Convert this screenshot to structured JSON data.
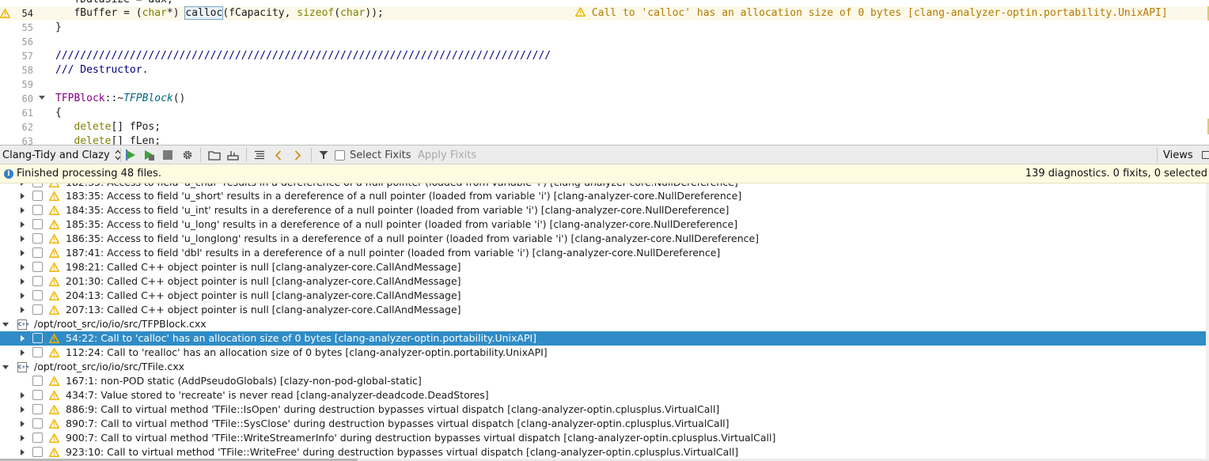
{
  "editor": {
    "lines": [
      {
        "num": "",
        "text": "   fDataSize = aux;"
      },
      {
        "num": "54",
        "current": true
      },
      {
        "num": "55",
        "text": "}"
      },
      {
        "num": "56",
        "text": ""
      },
      {
        "num": "57",
        "text": "////////////////////////////////////////////////////////////////////////////////"
      },
      {
        "num": "58",
        "text": "/// Destructor."
      },
      {
        "num": "59",
        "text": ""
      },
      {
        "num": "60"
      },
      {
        "num": "61",
        "text": "{"
      },
      {
        "num": "62"
      },
      {
        "num": "63"
      }
    ],
    "line54": {
      "pre": "   fBuffer = (",
      "type1": "char",
      "mid": "*) ",
      "calloc": "calloc",
      "args": "(fCapacity, ",
      "sizeof_kw": "sizeof",
      "paren": "(",
      "type2": "char",
      "end": "));"
    },
    "line60": {
      "cls": "TFPBlock",
      "sep": "::~",
      "fn": "TFPBlock",
      "end": "()"
    },
    "line62": {
      "kw": "   delete",
      "rest": "[] fPos;"
    },
    "line63": {
      "kw": "   delete",
      "rest": "[] fLen;"
    },
    "inline_diagnostic": "Call to 'calloc' has an allocation size of 0 bytes [clang-analyzer-optin.portability.UnixAPI]"
  },
  "toolbar": {
    "tool_select": "Clang-Tidy and Clazy",
    "select_fixits_label": "Select Fixits",
    "apply_fixits_label": "Apply Fixits",
    "views_label": "Views"
  },
  "infobar": {
    "message": "Finished processing 48 files.",
    "stats": "139 diagnostics. 0 fixits, 0 selected"
  },
  "tree": {
    "partial_row": "182:35: Access to field 'u_char' results in a dereference of a null pointer (loaded from variable 'i') [clang-analyzer-core.NullDereference]",
    "rows": [
      {
        "kind": "diag",
        "text": "183:35: Access to field 'u_short' results in a dereference of a null pointer (loaded from variable 'i') [clang-analyzer-core.NullDereference]",
        "expandable": true
      },
      {
        "kind": "diag",
        "text": "184:35: Access to field 'u_int' results in a dereference of a null pointer (loaded from variable 'i') [clang-analyzer-core.NullDereference]",
        "expandable": true
      },
      {
        "kind": "diag",
        "text": "185:35: Access to field 'u_long' results in a dereference of a null pointer (loaded from variable 'i') [clang-analyzer-core.NullDereference]",
        "expandable": true
      },
      {
        "kind": "diag",
        "text": "186:35: Access to field 'u_longlong' results in a dereference of a null pointer (loaded from variable 'i') [clang-analyzer-core.NullDereference]",
        "expandable": true
      },
      {
        "kind": "diag",
        "text": "187:41: Access to field 'dbl' results in a dereference of a null pointer (loaded from variable 'i') [clang-analyzer-core.NullDereference]",
        "expandable": true
      },
      {
        "kind": "diag",
        "text": "198:21: Called C++ object pointer is null [clang-analyzer-core.CallAndMessage]",
        "expandable": true
      },
      {
        "kind": "diag",
        "text": "201:30: Called C++ object pointer is null [clang-analyzer-core.CallAndMessage]",
        "expandable": true
      },
      {
        "kind": "diag",
        "text": "204:13: Called C++ object pointer is null [clang-analyzer-core.CallAndMessage]",
        "expandable": true
      },
      {
        "kind": "diag",
        "text": "207:13: Called C++ object pointer is null [clang-analyzer-core.CallAndMessage]",
        "expandable": true
      },
      {
        "kind": "file",
        "text": "/opt/root_src/io/io/src/TFPBlock.cxx"
      },
      {
        "kind": "diag",
        "text": "54:22: Call to 'calloc' has an allocation size of 0 bytes [clang-analyzer-optin.portability.UnixAPI]",
        "expandable": true,
        "selected": true
      },
      {
        "kind": "diag",
        "text": "112:24: Call to 'realloc' has an allocation size of 0 bytes [clang-analyzer-optin.portability.UnixAPI]",
        "expandable": true
      },
      {
        "kind": "file",
        "text": "/opt/root_src/io/io/src/TFile.cxx"
      },
      {
        "kind": "diag",
        "text": "167:1: non-POD static (AddPseudoGlobals) [clazy-non-pod-global-static]",
        "expandable": false
      },
      {
        "kind": "diag",
        "text": "434:7: Value stored to 'recreate' is never read [clang-analyzer-deadcode.DeadStores]",
        "expandable": true
      },
      {
        "kind": "diag",
        "text": "886:9: Call to virtual method 'TFile::IsOpen' during destruction bypasses virtual dispatch [clang-analyzer-optin.cplusplus.VirtualCall]",
        "expandable": true
      },
      {
        "kind": "diag",
        "text": "890:7: Call to virtual method 'TFile::SysClose' during destruction bypasses virtual dispatch [clang-analyzer-optin.cplusplus.VirtualCall]",
        "expandable": true
      },
      {
        "kind": "diag",
        "text": "900:7: Call to virtual method 'TFile::WriteStreamerInfo' during destruction bypasses virtual dispatch [clang-analyzer-optin.cplusplus.VirtualCall]",
        "expandable": true
      },
      {
        "kind": "diag",
        "text": "923:10: Call to virtual method 'TFile::WriteFree' during destruction bypasses virtual dispatch [clang-analyzer-optin.cplusplus.VirtualCall]",
        "expandable": true
      }
    ]
  },
  "colors": {
    "selection": "#308cc6",
    "warning": "#f0b400",
    "infobar_bg": "#fffbe1",
    "current_line_bg": "#fdf9ea"
  }
}
